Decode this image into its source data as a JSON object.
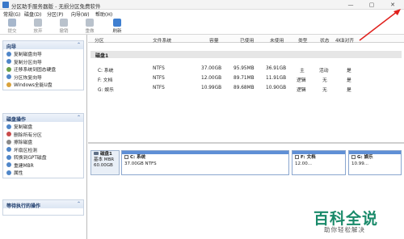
{
  "window": {
    "title": "分区助手服务器版 - 无损分区免费软件",
    "minimize": "—",
    "restore": "▢",
    "close": "✕"
  },
  "menu": [
    "常规(G)",
    "磁盘(D)",
    "分区(P)",
    "向导(W)",
    "帮助(H)"
  ],
  "toolbar": [
    {
      "label": "提交",
      "icon": "commit-icon",
      "color": "#a7b7cc"
    },
    {
      "label": "放弃",
      "icon": "discard-icon",
      "color": "#b9c2cc"
    },
    {
      "label": "撤销",
      "icon": "undo-icon",
      "color": "#b9c2cc"
    },
    {
      "label": "重做",
      "icon": "redo-icon",
      "color": "#b9c2cc"
    },
    {
      "label": "刷新",
      "icon": "refresh-icon",
      "color": "#3f7fd0"
    }
  ],
  "sidebar": {
    "wizard": {
      "title": "向导",
      "items": [
        "复制磁盘向导",
        "复制分区向导",
        "迁移系统到固态硬盘",
        "分区恢复向导",
        "Windows全能U盘"
      ]
    },
    "disk_ops": {
      "title": "磁盘操作",
      "items": [
        "复制磁盘",
        "删除所有分区",
        "擦除磁盘",
        "坏扇区检测",
        "转换到GPT磁盘",
        "重建MBR",
        "属性"
      ]
    },
    "pending": {
      "title": "等待执行的操作"
    }
  },
  "table": {
    "columns": [
      "分区",
      "文件系统",
      "容量",
      "已使用",
      "未使用",
      "类型",
      "状态",
      "4KB对齐"
    ],
    "disk_label": "磁盘1",
    "rows": [
      {
        "name": "C: 系统",
        "fs": "NTFS",
        "size": "37.00GB",
        "used": "95.95MB",
        "free": "36.91GB",
        "type": "主",
        "status": "活动",
        "align": "是"
      },
      {
        "name": "F: 文档",
        "fs": "NTFS",
        "size": "12.00GB",
        "used": "89.71MB",
        "free": "11.91GB",
        "type": "逻辑",
        "status": "无",
        "align": "是"
      },
      {
        "name": "G: 娱乐",
        "fs": "NTFS",
        "size": "10.99GB",
        "used": "89.68MB",
        "free": "10.90GB",
        "type": "逻辑",
        "status": "无",
        "align": "是"
      }
    ]
  },
  "diskmap": {
    "disk_name": "磁盘1",
    "disk_type": "基本 MBR",
    "disk_size": "60.00GB",
    "partitions": [
      {
        "name": "C: 系统",
        "desc": "37.00GB NTFS"
      },
      {
        "name": "F: 文档",
        "desc": "12.00..."
      },
      {
        "name": "G: 娱乐",
        "desc": "10.99..."
      }
    ]
  },
  "watermark": {
    "title": "百科全说",
    "subtitle": "助你轻松解决"
  },
  "colors": {
    "accent": "#3a78c9",
    "annotation": "#e0211d",
    "watermark": "#1a8a6a"
  }
}
